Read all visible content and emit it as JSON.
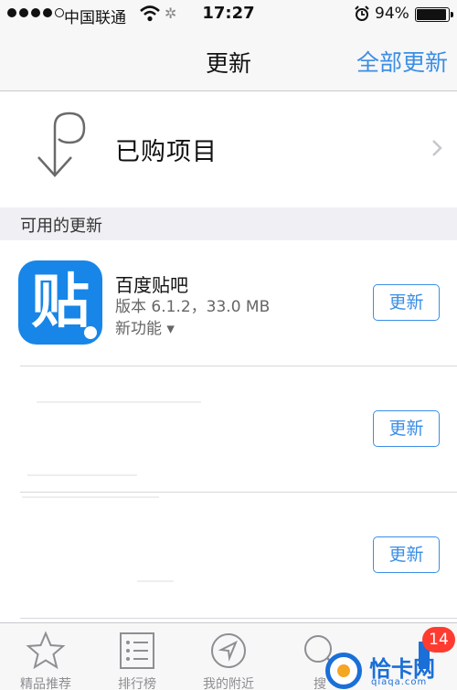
{
  "status_bar": {
    "carrier": "中国联通",
    "time": "17:27",
    "battery_percent": "94%",
    "battery_level": 0.94,
    "signal_bars": 4,
    "icons": [
      "signal-dots-icon",
      "wifi-icon",
      "activity-spinner-icon",
      "alarm-icon",
      "battery-icon"
    ]
  },
  "nav": {
    "title": "更新",
    "update_all": "全部更新"
  },
  "purchased": {
    "label": "已购项目",
    "icons": [
      "purchased-arrow-icon",
      "chevron-right-icon"
    ]
  },
  "section": {
    "available_updates": "可用的更新"
  },
  "apps": [
    {
      "name": "百度贴吧",
      "icon_glyph": "贴",
      "version": "版本 6.1.2，33.0 MB",
      "features": "新功能 ▾",
      "button": "更新"
    },
    {
      "button": "更新"
    },
    {
      "button": "更新"
    }
  ],
  "tabs": [
    {
      "label": "精品推荐",
      "icon": "star-icon"
    },
    {
      "label": "排行榜",
      "icon": "list-icon"
    },
    {
      "label": "我的附近",
      "icon": "location-icon"
    },
    {
      "label": "搜",
      "icon": "search-icon"
    },
    {
      "label": "",
      "icon": "updates-icon",
      "badge": "14"
    }
  ],
  "watermark": {
    "text": "恰卡网",
    "sub": "qiaqa.com"
  },
  "colors": {
    "accent": "#3b8ee6",
    "app_icon_blue": "#1786e8",
    "badge_red": "#ff3b30",
    "bar_background": "#f7f7f7",
    "section_background": "#efeff4"
  }
}
